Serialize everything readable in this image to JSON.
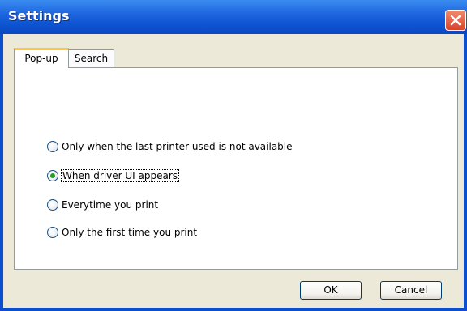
{
  "window": {
    "title": "Settings"
  },
  "tabs": [
    {
      "label": "Pop-up",
      "active": true
    },
    {
      "label": "Search",
      "active": false
    }
  ],
  "popup_options": {
    "items": [
      {
        "label": "Only when the last printer used is not available",
        "selected": false
      },
      {
        "label": "When driver UI appears",
        "selected": true
      },
      {
        "label": "Everytime you print",
        "selected": false
      },
      {
        "label": "Only the first time you print",
        "selected": false
      }
    ]
  },
  "buttons": {
    "ok": "OK",
    "cancel": "Cancel"
  },
  "icons": {
    "close": "close-icon"
  },
  "colors": {
    "titlebar": "#0a4fd0",
    "close": "#d9442a",
    "active_tab_accent": "#ffc83c",
    "radio_selected": "#21a121"
  }
}
